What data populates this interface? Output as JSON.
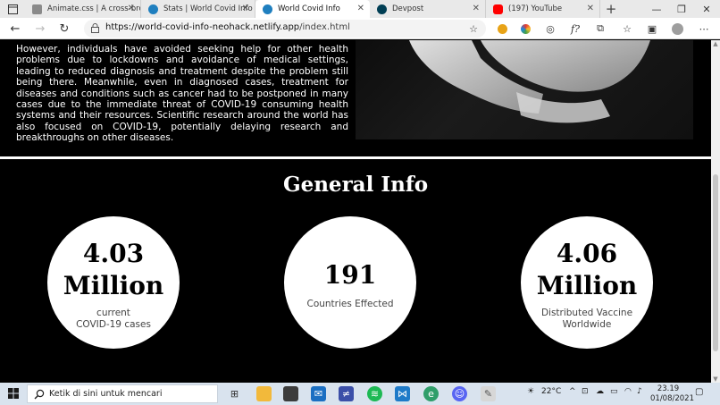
{
  "browser": {
    "tabs": [
      {
        "label": "Animate.css | A cross-bro",
        "icon": "animate-favicon-icon",
        "color": "#8a8a8a"
      },
      {
        "label": "Stats | World Covid Info",
        "icon": "globe-favicon-icon",
        "color": "#1f7fbf"
      },
      {
        "label": "World Covid Info",
        "icon": "globe-favicon-icon",
        "color": "#1f7fbf"
      },
      {
        "label": "Devpost",
        "icon": "devpost-favicon-icon",
        "color": "#003e54"
      },
      {
        "label": "(197) YouTube",
        "icon": "youtube-favicon-icon",
        "color": "#ff0000"
      }
    ],
    "active_tab": 2,
    "url_host": "https://world-covid-info-neohack.netlify.app",
    "url_path": "/index.html"
  },
  "page": {
    "paragraph": "However, individuals have avoided seeking help for other health problems due to lockdowns and avoidance of medical settings, leading to reduced diagnosis and treatment despite the problem still being there. Meanwhile, even in diagnosed cases, treatment for diseases and conditions such as cancer had to be postponed in many cases due to the immediate threat of COVID-19 consuming health systems and their resources. Scientific research around the world has also focused on COVID-19, potentially delaying research and breakthroughs on other diseases.",
    "section_title": "General Info",
    "stats": [
      {
        "value_line1": "4.03",
        "value_line2": "Million",
        "label_line1": "current",
        "label_line2": "COVID-19 cases"
      },
      {
        "value_line1": "191",
        "value_line2": "",
        "label_line1": "Countries Effected",
        "label_line2": ""
      },
      {
        "value_line1": "4.06",
        "value_line2": "Million",
        "label_line1": "Distributed Vaccine",
        "label_line2": "Worldwide"
      }
    ]
  },
  "taskbar": {
    "search_placeholder": "Ketik di sini untuk mencari",
    "weather": "22°C",
    "time": "23.19",
    "date": "01/08/2021"
  }
}
